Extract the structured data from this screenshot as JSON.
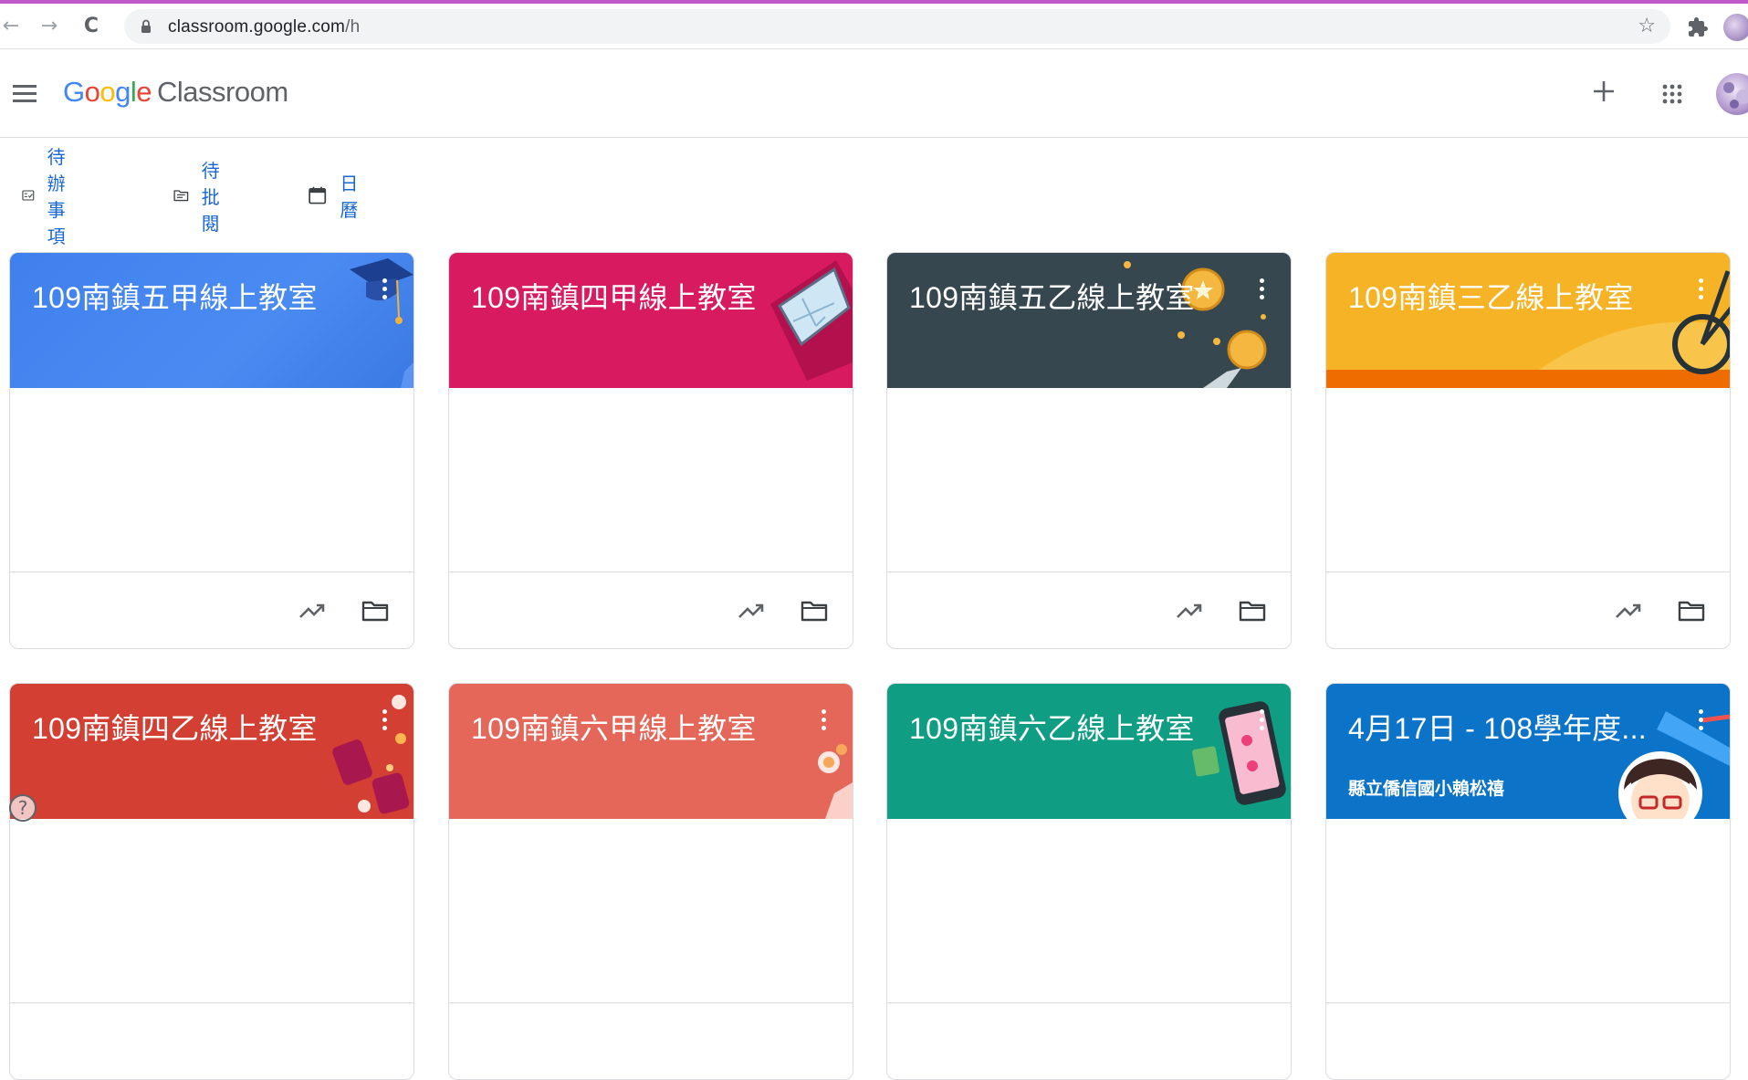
{
  "browser": {
    "url_host": "classroom.google.com",
    "url_path": "/h",
    "back_glyph": "←",
    "forward_glyph": "→",
    "reload_glyph": "C",
    "star_glyph": "☆",
    "accent": "#c058c9"
  },
  "appbar": {
    "logo_letters": [
      "G",
      "o",
      "o",
      "g",
      "l",
      "e"
    ],
    "product_name": "Classroom",
    "icons": [
      "menu-icon",
      "plus-icon",
      "apps-icon",
      "avatar"
    ]
  },
  "subnav": {
    "items": [
      {
        "label": "待辦事項",
        "icon": "todo-icon"
      },
      {
        "label": "待批閱",
        "icon": "review-folder-icon"
      },
      {
        "label": "日曆",
        "icon": "calendar-icon"
      }
    ]
  },
  "cards": [
    {
      "title": "109南鎮五甲線上教室",
      "subtitle": "",
      "color": "#4285f4",
      "theme": "graduation"
    },
    {
      "title": "109南鎮四甲線上教室",
      "subtitle": "",
      "color": "#d81b60",
      "theme": "tablet"
    },
    {
      "title": "109南鎮五乙線上教室",
      "subtitle": "",
      "color": "#37474f",
      "theme": "medals"
    },
    {
      "title": "109南鎮三乙線上教室",
      "subtitle": "",
      "color": "#f5b325",
      "theme": "bicycle"
    },
    {
      "title": "109南鎮四乙線上教室",
      "subtitle": "",
      "color": "#d33f32",
      "theme": "tickets"
    },
    {
      "title": "109南鎮六甲線上教室",
      "subtitle": "",
      "color": "#e46759",
      "theme": "cafe"
    },
    {
      "title": "109南鎮六乙線上教室",
      "subtitle": "",
      "color": "#0f9d83",
      "theme": "phone"
    },
    {
      "title": "4月17日 - 108學年度...",
      "subtitle": "縣立僑信國小賴松禧",
      "color": "#0b73c8",
      "theme": "cartoon"
    }
  ]
}
